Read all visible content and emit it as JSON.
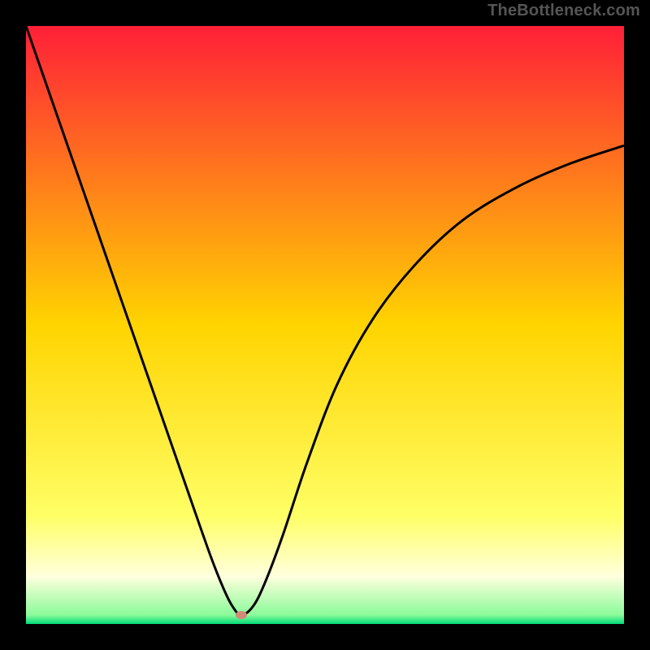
{
  "attribution": "TheBottleneck.com",
  "chart_data": {
    "type": "line",
    "title": "",
    "xlabel": "",
    "ylabel": "",
    "xlim": [
      0,
      100
    ],
    "ylim": [
      0,
      100
    ],
    "background_gradient": {
      "stops": [
        {
          "pos": 0.0,
          "color": "#ff1f38"
        },
        {
          "pos": 0.5,
          "color": "#ffd400"
        },
        {
          "pos": 0.82,
          "color": "#ffff66"
        },
        {
          "pos": 0.92,
          "color": "#ffffdd"
        },
        {
          "pos": 0.985,
          "color": "#8bfb9a"
        },
        {
          "pos": 1.0,
          "color": "#00d977"
        }
      ]
    },
    "optimum_marker": {
      "x": 36,
      "y": 1.5,
      "color": "#d08a77"
    },
    "series": [
      {
        "name": "bottleneck-curve",
        "x": [
          0,
          4,
          8,
          12,
          16,
          20,
          24,
          28,
          31,
          33,
          34.5,
          36,
          38,
          40,
          43,
          47,
          52,
          58,
          65,
          73,
          82,
          91,
          100
        ],
        "y": [
          100,
          88.5,
          77,
          65.5,
          54,
          42.5,
          31,
          19.5,
          11,
          6,
          3,
          1.5,
          3,
          7,
          15,
          27,
          40,
          51,
          60,
          67.5,
          73,
          77,
          80
        ]
      }
    ]
  }
}
